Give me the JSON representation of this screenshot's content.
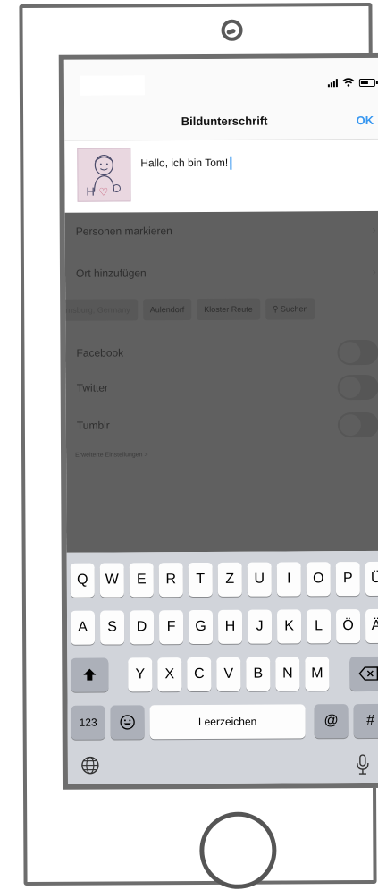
{
  "nav": {
    "title": "Bildunterschrift",
    "ok_label": "OK"
  },
  "caption": {
    "value": "Hallo, ich bin Tom!",
    "thumbnail_letters": "H",
    "thumbnail_heart": "♡"
  },
  "options": {
    "tag_people": "Personen markieren",
    "add_location": "Ort hinzufügen",
    "location_chips": [
      "rnsburg, Germany",
      "Aulendorf",
      "Kloster Reute",
      "Suchen"
    ],
    "share": [
      {
        "label": "Facebook",
        "enabled": false
      },
      {
        "label": "Twitter",
        "enabled": false
      },
      {
        "label": "Tumblr",
        "enabled": false
      }
    ],
    "advanced": "Erweiterte Einstellungen >"
  },
  "icons": {
    "chevron": "chevron-right-icon",
    "search": "search-icon",
    "shift": "shift-arrow-icon",
    "backspace": "backspace-icon",
    "emoji": "emoji-icon",
    "globe": "globe-icon",
    "mic": "microphone-icon",
    "wifi": "wifi-icon",
    "battery": "battery-icon",
    "signal": "signal-icon"
  },
  "keyboard": {
    "row1": [
      "Q",
      "W",
      "E",
      "R",
      "T",
      "Z",
      "U",
      "I",
      "O",
      "P",
      "Ü"
    ],
    "row2": [
      "A",
      "S",
      "D",
      "F",
      "G",
      "H",
      "J",
      "K",
      "L",
      "Ö",
      "Ä"
    ],
    "row3": [
      "Y",
      "X",
      "C",
      "V",
      "B",
      "N",
      "M"
    ],
    "numbers_label": "123",
    "space_label": "Leerzeichen",
    "at_label": "@",
    "hash_label": "#"
  },
  "colors": {
    "accent": "#3897f0",
    "dim_overlay": "#606060",
    "keyboard_bg": "#d1d4da"
  }
}
